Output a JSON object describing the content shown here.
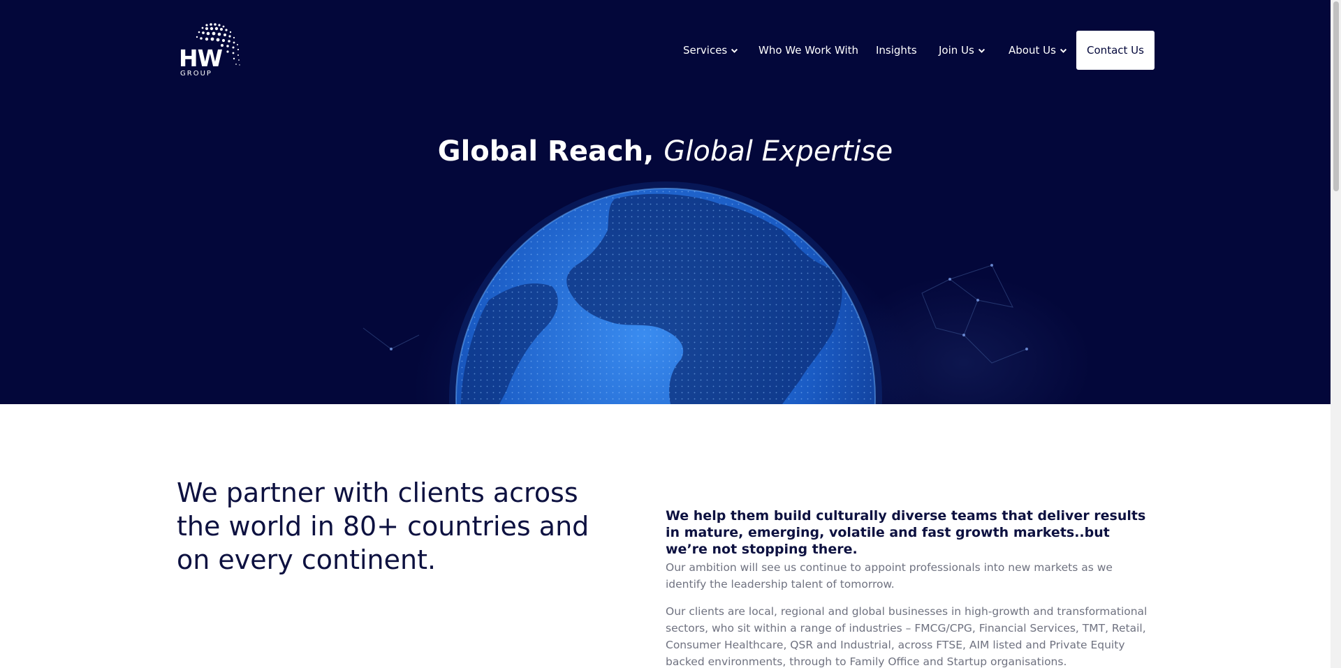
{
  "brand": {
    "logo_main": "HW",
    "logo_sub": "GROUP"
  },
  "nav": {
    "items": [
      {
        "label": "Services",
        "dropdown": true
      },
      {
        "label": "Who We Work With",
        "dropdown": false
      },
      {
        "label": "Insights",
        "dropdown": false
      },
      {
        "label": "Join Us",
        "dropdown": true
      },
      {
        "label": "About Us",
        "dropdown": true
      }
    ],
    "cta": "Contact Us"
  },
  "hero": {
    "title_strong": "Global Reach,",
    "title_em": "Global Expertise"
  },
  "intro": {
    "lead": "We partner with clients across the world in 80+ countries and on every continent.",
    "subheading": "We help them build culturally diverse teams that deliver results in mature, emerging, volatile and fast growth markets..but we’re not stopping there.",
    "paragraph_1": "Our ambition will see us continue to appoint professionals into new markets as we identify the leadership talent of tomorrow.",
    "paragraph_2": "Our clients are local, regional and global businesses in high-growth and transformational sectors, who sit within a range of industries – FMCG/CPG, Financial Services, TMT, Retail, Consumer Healthcare, QSR and Industrial, across FTSE, AIM listed and Private Equity backed environments, through to Family Office and Startup organisations."
  },
  "colors": {
    "hero_bg": "#03073a",
    "heading": "#0d1140",
    "body_text": "#6f7280",
    "globe_blue": "#2f7de0"
  },
  "icons": {
    "logo": "globe-dots-logo",
    "dropdown": "chevron-down-icon"
  }
}
